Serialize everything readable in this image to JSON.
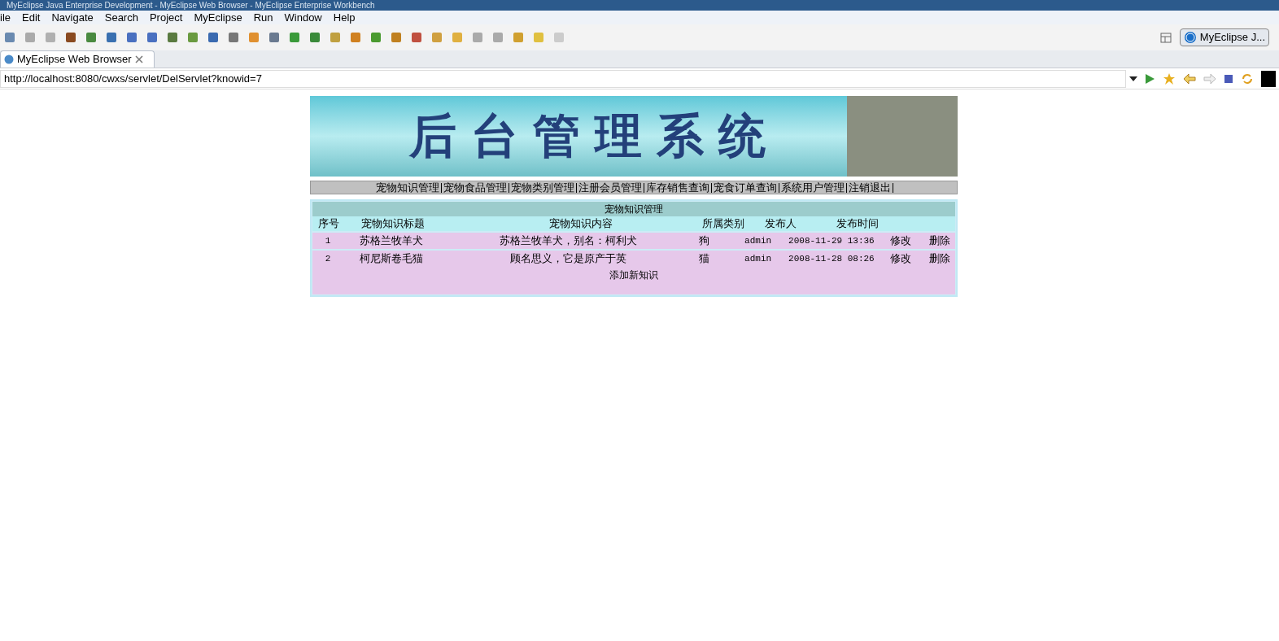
{
  "window": {
    "title": "MyEclipse Java Enterprise Development - MyEclipse Web Browser - MyEclipse Enterprise Workbench"
  },
  "menu": [
    "ile",
    "Edit",
    "Navigate",
    "Search",
    "Project",
    "MyEclipse",
    "Run",
    "Window",
    "Help"
  ],
  "perspective": {
    "label": "MyEclipse J..."
  },
  "tabs": [
    {
      "label": "MyEclipse Web Browser",
      "selected": true
    }
  ],
  "address": {
    "value": "http://localhost:8080/cwxs/servlet/DelServlet?knowid=7"
  },
  "page": {
    "banner_title": "后台管理系统",
    "nav": [
      "宠物知识管理",
      "宠物食品管理",
      "宠物类别管理",
      "注册会员管理",
      "库存销售查询",
      "宠食订单查询",
      "系统用户管理",
      "注销退出"
    ],
    "table": {
      "title": "宠物知识管理",
      "columns": [
        "序号",
        "宠物知识标题",
        "宠物知识内容",
        "所属类别",
        "发布人",
        "发布时间"
      ],
      "rows": [
        {
          "cells": [
            "1",
            "苏格兰牧羊犬",
            "苏格兰牧羊犬，别名：柯利犬",
            "狗",
            "admin",
            "2008-11-29 13:36"
          ],
          "actions": [
            "修改",
            "删除"
          ]
        },
        {
          "cells": [
            "2",
            "柯尼斯卷毛猫",
            "顾名思义，它是原产于英",
            "猫",
            "admin",
            "2008-11-28 08:26"
          ],
          "actions": [
            "修改",
            "删除"
          ]
        }
      ],
      "add_link": "添加新知识"
    }
  }
}
